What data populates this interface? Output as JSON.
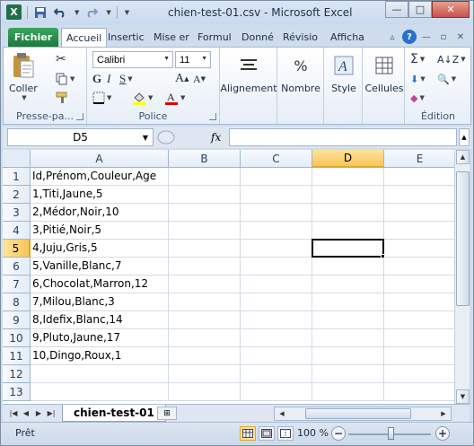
{
  "window": {
    "title": "chien-test-01.csv  -  Microsoft Excel",
    "app_icon_letter": "X"
  },
  "quick_access": {
    "save_icon": "save-icon",
    "undo_icon": "undo-icon",
    "redo_icon": "redo-icon"
  },
  "window_controls": {
    "minimize": "—",
    "maximize": "□",
    "close": "✕"
  },
  "tabs": [
    {
      "label": "Fichier"
    },
    {
      "label": "Accueil"
    },
    {
      "label": "Insertic"
    },
    {
      "label": "Mise er"
    },
    {
      "label": "Formul"
    },
    {
      "label": "Donné"
    },
    {
      "label": "Révisio"
    },
    {
      "label": "Afficha"
    }
  ],
  "ribbon": {
    "clipboard": {
      "paste_label": "Coller",
      "group_label": "Presse-pa..."
    },
    "font": {
      "name": "Calibri",
      "size": "11",
      "group_label": "Police",
      "underline_color": "#ffff00",
      "font_color": "#e00000"
    },
    "alignment_label": "Alignement",
    "number_label": "Nombre",
    "style_label": "Style",
    "cells_label": "Cellules",
    "editing_label": "Édition"
  },
  "formula_bar": {
    "name_box": "D5",
    "fx": "fx",
    "content": ""
  },
  "grid": {
    "columns": [
      "A",
      "B",
      "C",
      "D",
      "E"
    ],
    "selected_column": "D",
    "rows": [
      "1",
      "2",
      "3",
      "4",
      "5",
      "6",
      "7",
      "8",
      "9",
      "10",
      "11",
      "12",
      "13"
    ],
    "selected_row": "5",
    "cells_A": [
      "Id,Prénom,Couleur,Age",
      "1,Titi,Jaune,5",
      "2,Médor,Noir,10",
      "3,Pitié,Noir,5",
      "4,Juju,Gris,5",
      "5,Vanille,Blanc,7",
      "6,Chocolat,Marron,12",
      "7,Milou,Blanc,3",
      "8,Idefix,Blanc,14",
      "9,Pluto,Jaune,17",
      "10,Dingo,Roux,1",
      "",
      ""
    ],
    "selection_color": "#f8c55a"
  },
  "sheets": {
    "active": "chien-test-01"
  },
  "status": {
    "ready": "Prêt",
    "zoom": "100 %"
  }
}
